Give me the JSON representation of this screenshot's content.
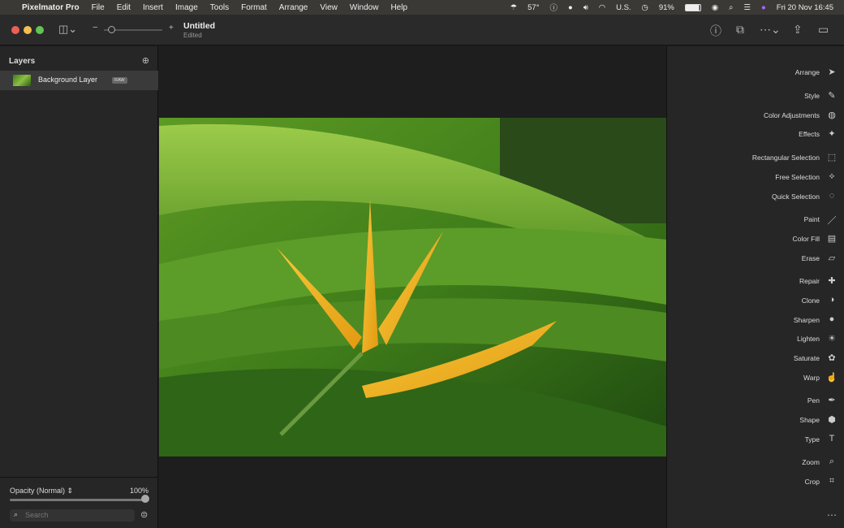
{
  "menubar": {
    "app": "Pixelmator Pro",
    "items": [
      "File",
      "Edit",
      "Insert",
      "Image",
      "Tools",
      "Format",
      "Arrange",
      "View",
      "Window",
      "Help"
    ],
    "status": {
      "temperature": "57°",
      "keyboard": "U.S.",
      "battery": "91%",
      "datetime": "Fri 20 Nov  16:45"
    }
  },
  "window": {
    "title": "Untitled",
    "subtitle": "Edited"
  },
  "layers": {
    "heading": "Layers",
    "items": [
      {
        "name": "Background Layer",
        "badge": "RAW"
      }
    ],
    "opacity_label": "Opacity (Normal)",
    "opacity_value": "100%",
    "opacity_fraction": 1.0,
    "search_placeholder": "Search"
  },
  "tools": [
    "Arrange",
    "Style",
    "Color Adjustments",
    "Effects",
    "Rectangular Selection",
    "Free Selection",
    "Quick Selection",
    "Paint",
    "Color Fill",
    "Erase",
    "Repair",
    "Clone",
    "Sharpen",
    "Lighten",
    "Saturate",
    "Warp",
    "Pen",
    "Shape",
    "Type",
    "Zoom",
    "Crop"
  ],
  "colors": {
    "close": "#ec5f56",
    "minimize": "#f4bf4f",
    "maximize": "#61c454"
  }
}
